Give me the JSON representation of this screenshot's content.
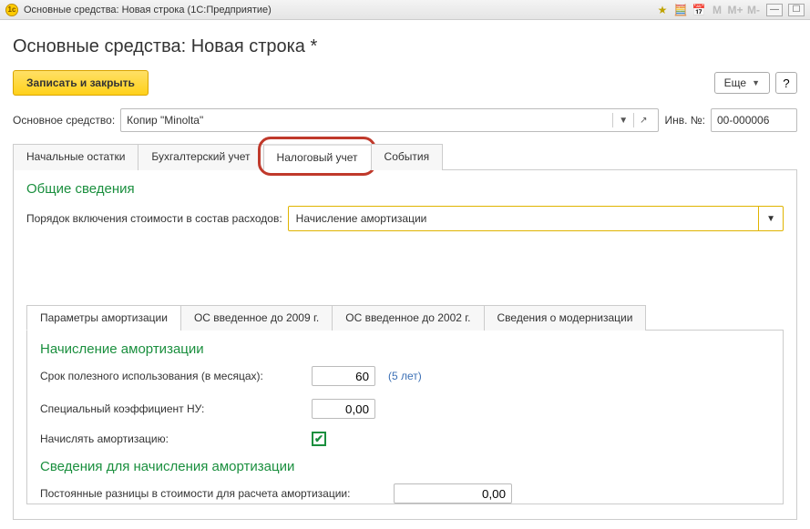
{
  "window": {
    "title": "Основные средства: Новая строка  (1С:Предприятие)"
  },
  "page": {
    "title": "Основные средства: Новая строка *"
  },
  "toolbar": {
    "save_label": "Записать и закрыть",
    "more_label": "Еще",
    "help_label": "?"
  },
  "main_field": {
    "label": "Основное средство:",
    "value": "Копир \"Minolta\"",
    "inv_label": "Инв. №:",
    "inv_value": "00-000006"
  },
  "tabs": {
    "t1": "Начальные остатки",
    "t2": "Бухгалтерский учет",
    "t3": "Налоговый учет",
    "t4": "События"
  },
  "section": {
    "general_title": "Общие сведения",
    "expense_label": "Порядок включения стоимости в состав расходов:",
    "expense_value": "Начисление амортизации"
  },
  "subtabs": {
    "s1": "Параметры амортизации",
    "s2": "ОС введенное до 2009 г.",
    "s3": "ОС введенное до 2002 г.",
    "s4": "Сведения о модернизации"
  },
  "amort": {
    "title": "Начисление амортизации",
    "life_label": "Срок полезного использования (в месяцах):",
    "life_value": "60",
    "life_hint": "(5 лет)",
    "coef_label": "Специальный коэффициент НУ:",
    "coef_value": "0,00",
    "charge_label": "Начислять амортизацию:",
    "charge_checked": true,
    "calc_title": "Сведения для начисления амортизации",
    "diff_label": "Постоянные разницы в стоимости для расчета амортизации:",
    "diff_value": "0,00"
  }
}
